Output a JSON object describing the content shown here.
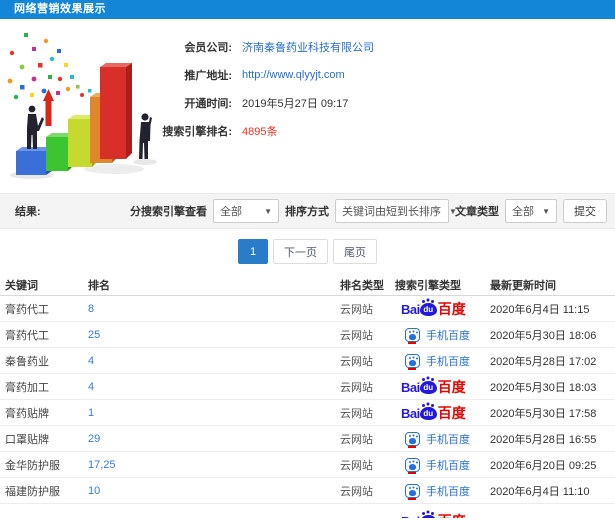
{
  "header": {
    "title": "网络营销效果展示",
    "bg_color": "#1486d8"
  },
  "info": {
    "rows": [
      {
        "label": "会员公司:",
        "value": "济南秦鲁药业科技有限公司",
        "style": "link"
      },
      {
        "label": "推广地址:",
        "value": "http://www.qlyyjt.com",
        "style": "link"
      },
      {
        "label": "开通时间:",
        "value": "2019年5月27日 09:17",
        "style": "text"
      },
      {
        "label": "搜索引擎排名:",
        "value": "4895条",
        "style": "hot"
      }
    ],
    "highlight_color": "#f03224",
    "link_color": "#2a6fc9"
  },
  "filter": {
    "result_label": "结果:",
    "engine_label": "分搜索引擎查看",
    "engine_value": "全部",
    "sort_label": "排序方式",
    "sort_value": "关键词由短到长排序",
    "article_label": "文章类型",
    "article_value": "全部",
    "submit_label": "提交",
    "caret_icon": "▼"
  },
  "pagination": {
    "current": "1",
    "next_label": "下一页",
    "last_label": "尾页",
    "active_color": "#2a7cc9"
  },
  "table": {
    "headers": [
      "关键词",
      "排名",
      "排名类型",
      "搜索引擎类型",
      "最新更新时间"
    ],
    "engine_logo": {
      "bai": "Bai",
      "du": "du",
      "cn": "百度",
      "mobile_label": "手机百度",
      "baidu_blue": "#2319dc",
      "baidu_red": "#e10601",
      "mobile_blue": "#2a6fd8"
    },
    "rows": [
      {
        "keyword": "膏药代工",
        "rank": "8",
        "rank_type": "云网站",
        "engine": "baidu",
        "updated": "2020年6月4日 11:15"
      },
      {
        "keyword": "膏药代工",
        "rank": "25",
        "rank_type": "云网站",
        "engine": "mobile-baidu",
        "updated": "2020年5月30日 18:06"
      },
      {
        "keyword": "秦鲁药业",
        "rank": "4",
        "rank_type": "云网站",
        "engine": "mobile-baidu",
        "updated": "2020年5月28日 17:02"
      },
      {
        "keyword": "膏药加工",
        "rank": "4",
        "rank_type": "云网站",
        "engine": "baidu",
        "updated": "2020年5月30日 18:03"
      },
      {
        "keyword": "膏药贴牌",
        "rank": "1",
        "rank_type": "云网站",
        "engine": "baidu",
        "updated": "2020年5月30日 17:58"
      },
      {
        "keyword": "口罩贴牌",
        "rank": "29",
        "rank_type": "云网站",
        "engine": "mobile-baidu",
        "updated": "2020年5月28日 16:55"
      },
      {
        "keyword": "金华防护服",
        "rank": "17,25",
        "rank_type": "云网站",
        "engine": "mobile-baidu",
        "updated": "2020年6月20日 09:25"
      },
      {
        "keyword": "福建防护服",
        "rank": "10",
        "rank_type": "云网站",
        "engine": "mobile-baidu",
        "updated": "2020年6月4日 11:10"
      }
    ],
    "partial_next_row_engine": "baidu"
  }
}
